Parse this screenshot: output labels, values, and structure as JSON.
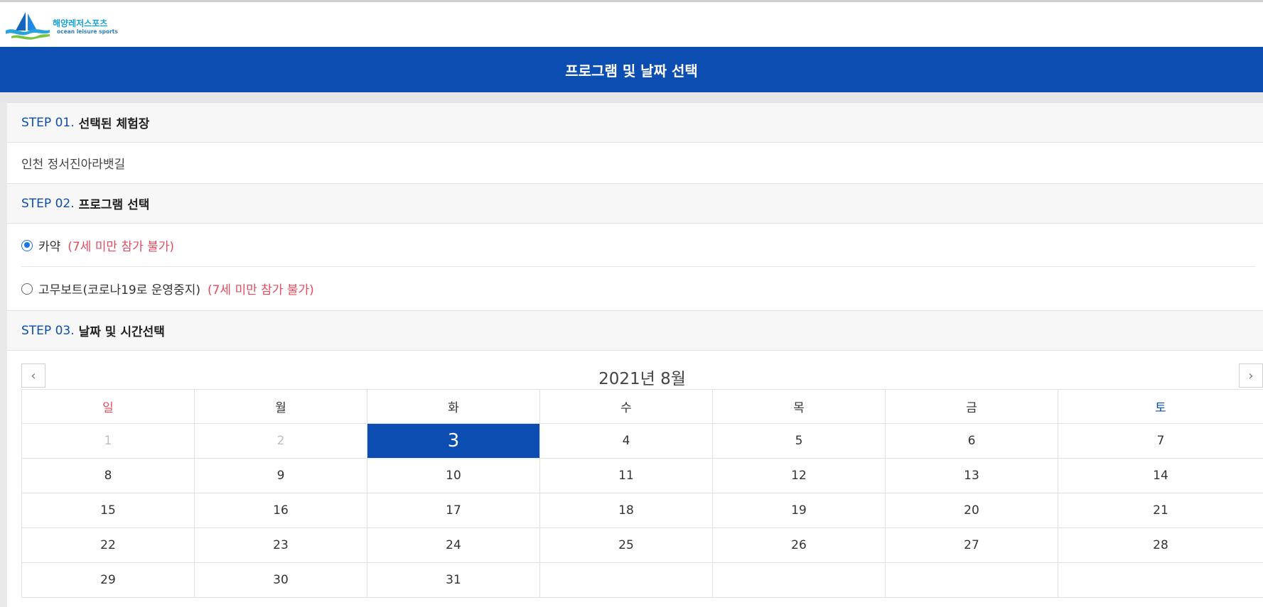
{
  "logo": {
    "korean": "해양레저스포츠",
    "english": "ocean leisure sports"
  },
  "page_title": "프로그램 및 날짜 선택",
  "step1": {
    "num": "STEP 01.",
    "title": "선택된 체험장",
    "facility": "인천 정서진아라뱃길"
  },
  "step2": {
    "num": "STEP 02.",
    "title": "프로그램 선택",
    "programs": [
      {
        "label": "카약",
        "note": "(7세 미만 참가 불가)",
        "checked": true
      },
      {
        "label": "고무보트(코로나19로 운영중지)",
        "note": "(7세 미만 참가 불가)",
        "checked": false
      }
    ]
  },
  "step3": {
    "num": "STEP 03.",
    "title": "날짜 및 시간선택"
  },
  "calendar": {
    "prev": "‹",
    "next": "›",
    "month_title": "2021년 8월",
    "weekdays": [
      "일",
      "월",
      "화",
      "수",
      "목",
      "금",
      "토"
    ],
    "weeks": [
      [
        "1",
        "2",
        "3",
        "4",
        "5",
        "6",
        "7"
      ],
      [
        "8",
        "9",
        "10",
        "11",
        "12",
        "13",
        "14"
      ],
      [
        "15",
        "16",
        "17",
        "18",
        "19",
        "20",
        "21"
      ],
      [
        "22",
        "23",
        "24",
        "25",
        "26",
        "27",
        "28"
      ],
      [
        "29",
        "30",
        "31",
        "",
        "",
        "",
        ""
      ]
    ],
    "selected_day": "3",
    "past_days": [
      "1",
      "2"
    ]
  },
  "colors": {
    "primary": "#0b4db0",
    "warning": "#e84a5f"
  }
}
